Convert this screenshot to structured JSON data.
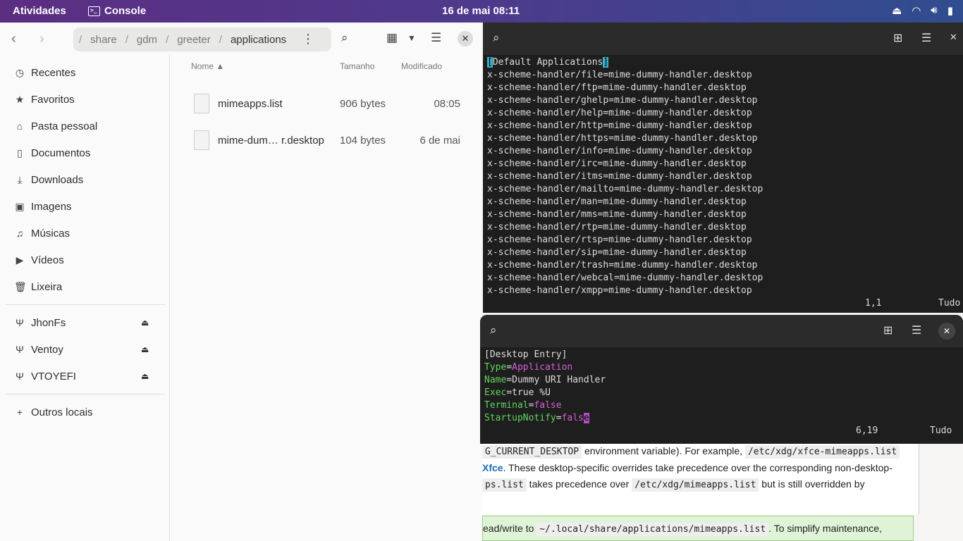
{
  "topbar": {
    "activities": "Atividades",
    "app_name": "Console",
    "clock": "16 de mai  08:11"
  },
  "file_manager": {
    "path": [
      "share",
      "gdm",
      "greeter",
      "applications"
    ],
    "sidebar": {
      "places": [
        {
          "label": "Recentes",
          "icon": "clock-icon"
        },
        {
          "label": "Favoritos",
          "icon": "star-icon"
        },
        {
          "label": "Pasta pessoal",
          "icon": "home-icon"
        },
        {
          "label": "Documentos",
          "icon": "document-icon"
        },
        {
          "label": "Downloads",
          "icon": "download-icon"
        },
        {
          "label": "Imagens",
          "icon": "image-icon"
        },
        {
          "label": "Músicas",
          "icon": "music-icon"
        },
        {
          "label": "Vídeos",
          "icon": "video-icon"
        },
        {
          "label": "Lixeira",
          "icon": "trash-icon"
        }
      ],
      "devices": [
        {
          "label": "JhonFs",
          "icon": "usb-icon"
        },
        {
          "label": "Ventoy",
          "icon": "usb-icon"
        },
        {
          "label": "VTOYEFI",
          "icon": "usb-icon"
        }
      ],
      "other": "Outros locais"
    },
    "columns": {
      "name": "Nome",
      "size": "Tamanho",
      "modified": "Modificado"
    },
    "files": [
      {
        "name": "mimeapps.list",
        "size": "906 bytes",
        "modified": "08:05"
      },
      {
        "name": "mime-dum… r.desktop",
        "size": "104 bytes",
        "modified": "6 de mai"
      }
    ]
  },
  "terminal1": {
    "first_line_open": "[",
    "first_line_text": "Default Applications",
    "first_line_close": "]",
    "lines": [
      "x-scheme-handler/file=mime-dummy-handler.desktop",
      "x-scheme-handler/ftp=mime-dummy-handler.desktop",
      "x-scheme-handler/ghelp=mime-dummy-handler.desktop",
      "x-scheme-handler/help=mime-dummy-handler.desktop",
      "x-scheme-handler/http=mime-dummy-handler.desktop",
      "x-scheme-handler/https=mime-dummy-handler.desktop",
      "x-scheme-handler/info=mime-dummy-handler.desktop",
      "x-scheme-handler/irc=mime-dummy-handler.desktop",
      "x-scheme-handler/itms=mime-dummy-handler.desktop",
      "x-scheme-handler/mailto=mime-dummy-handler.desktop",
      "x-scheme-handler/man=mime-dummy-handler.desktop",
      "x-scheme-handler/mms=mime-dummy-handler.desktop",
      "x-scheme-handler/rtp=mime-dummy-handler.desktop",
      "x-scheme-handler/rtsp=mime-dummy-handler.desktop",
      "x-scheme-handler/sip=mime-dummy-handler.desktop",
      "x-scheme-handler/trash=mime-dummy-handler.desktop",
      "x-scheme-handler/webcal=mime-dummy-handler.desktop",
      "x-scheme-handler/xmpp=mime-dummy-handler.desktop"
    ],
    "position": "1,1",
    "scroll": "Tudo"
  },
  "terminal2": {
    "header": "[Desktop Entry]",
    "entries": [
      {
        "key": "Type",
        "value": "Application",
        "value_color": "v"
      },
      {
        "key": "Name",
        "value": "Dummy URI Handler",
        "value_color": ""
      },
      {
        "key": "Exec",
        "value": "true %U",
        "value_color": ""
      },
      {
        "key": "Terminal",
        "value": "false",
        "value_color": "v"
      }
    ],
    "last_key": "StartupNotify",
    "last_value": "fals",
    "last_cursor": "e",
    "position": "6,19",
    "scroll": "Tudo"
  },
  "web": {
    "line1_code1": "G_CURRENT_DESKTOP",
    "line1_text": " environment variable). For example, ",
    "line1_code2": "/etc/xdg/xfce-mimeapps.list",
    "line2_link": "Xfce",
    "line2_text": ". These desktop-specific overrides take precedence over the corresponding non-desktop-",
    "line3_code1": "ps.list",
    "line3_text1": " takes precedence over ",
    "line3_code2": "/etc/xdg/mimeapps.list",
    "line3_text2": " but is still overridden by",
    "tip_text1": "ead/write to ",
    "tip_code": "~/.local/share/applications/mimeapps.list",
    "tip_text2": ". To simplify maintenance,"
  }
}
